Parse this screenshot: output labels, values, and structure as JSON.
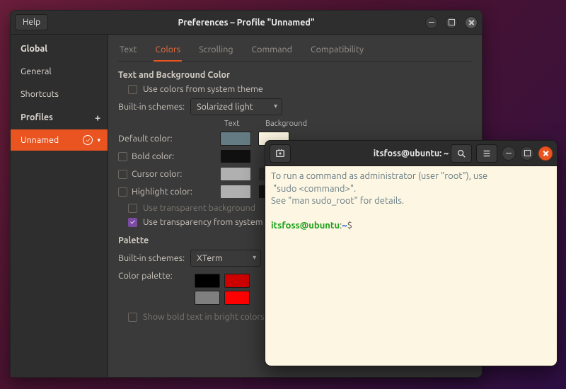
{
  "prefs": {
    "help_label": "Help",
    "title": "Preferences – Profile \"Unnamed\"",
    "sidebar": {
      "global": "Global",
      "general": "General",
      "shortcuts": "Shortcuts",
      "profiles_header": "Profiles",
      "profile_name": "Unnamed"
    },
    "tabs": [
      "Text",
      "Colors",
      "Scrolling",
      "Command",
      "Compatibility"
    ],
    "active_tab": "Colors",
    "section_text_bg": "Text and Background Color",
    "use_system_colors": "Use colors from system theme",
    "builtin_label": "Built-in schemes:",
    "builtin_value": "Solarized light",
    "col_text": "Text",
    "col_bg": "Background",
    "rows": {
      "default": "Default color:",
      "bold": "Bold color:",
      "cursor": "Cursor color:",
      "highlight": "Highlight color:"
    },
    "swatches": {
      "default_text": "#657b83",
      "default_bg": "#fdf6e3",
      "bold_text": "#101010",
      "cursor_text": "#b0b0b0",
      "cursor_bg": "#2a2a2a",
      "highlight_text": "#b0b0b0",
      "highlight_bg": "#141414"
    },
    "transparent_bg": "Use transparent background",
    "transparency_system": "Use transparency from system theme",
    "palette_header": "Palette",
    "palette_scheme_label": "Built-in schemes:",
    "palette_scheme_value": "XTerm",
    "palette_label": "Color palette:",
    "palette_row1": [
      "#000000",
      "#cd0000"
    ],
    "palette_row2": [
      "#7f7f7f",
      "#ff0000"
    ],
    "show_bold_bright": "Show bold text in bright colors"
  },
  "terminal": {
    "title": "itsfoss@ubuntu: ~",
    "msg_line1": "To run a command as administrator (user \"root\"), use",
    "msg_line2": " \"sudo <command>\".",
    "msg_line3": "See \"man sudo_root\" for details.",
    "prompt_user": "itsfoss@ubuntu",
    "prompt_sep": ":",
    "prompt_path": "~",
    "prompt_end": "$"
  }
}
